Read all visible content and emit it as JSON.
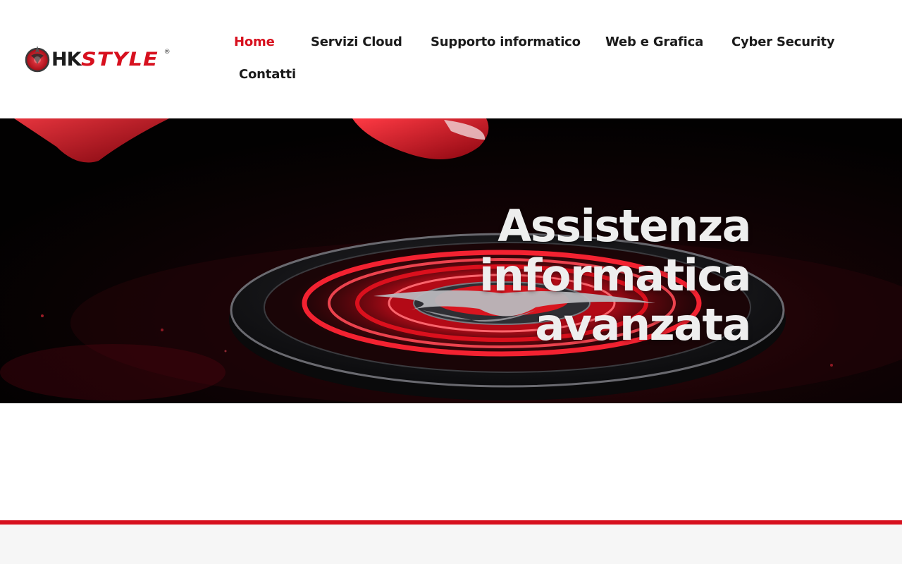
{
  "brand": {
    "logo_text_hk": "HK",
    "logo_text_style": "STYLE",
    "logo_reg": "®",
    "accent_color": "#d7101e"
  },
  "nav": {
    "items": [
      {
        "label": "Home",
        "active": true
      },
      {
        "label": "Servizi Cloud",
        "active": false
      },
      {
        "label": "Supporto informatico",
        "active": false
      },
      {
        "label": "Web e Grafica",
        "active": false
      },
      {
        "label": "Cyber Security",
        "active": false
      },
      {
        "label": "Contatti",
        "active": false
      }
    ]
  },
  "hero": {
    "title_lines": [
      "Assistenza",
      "informatica",
      "avanzata"
    ],
    "image": "red-glowing-button-with-logo"
  }
}
